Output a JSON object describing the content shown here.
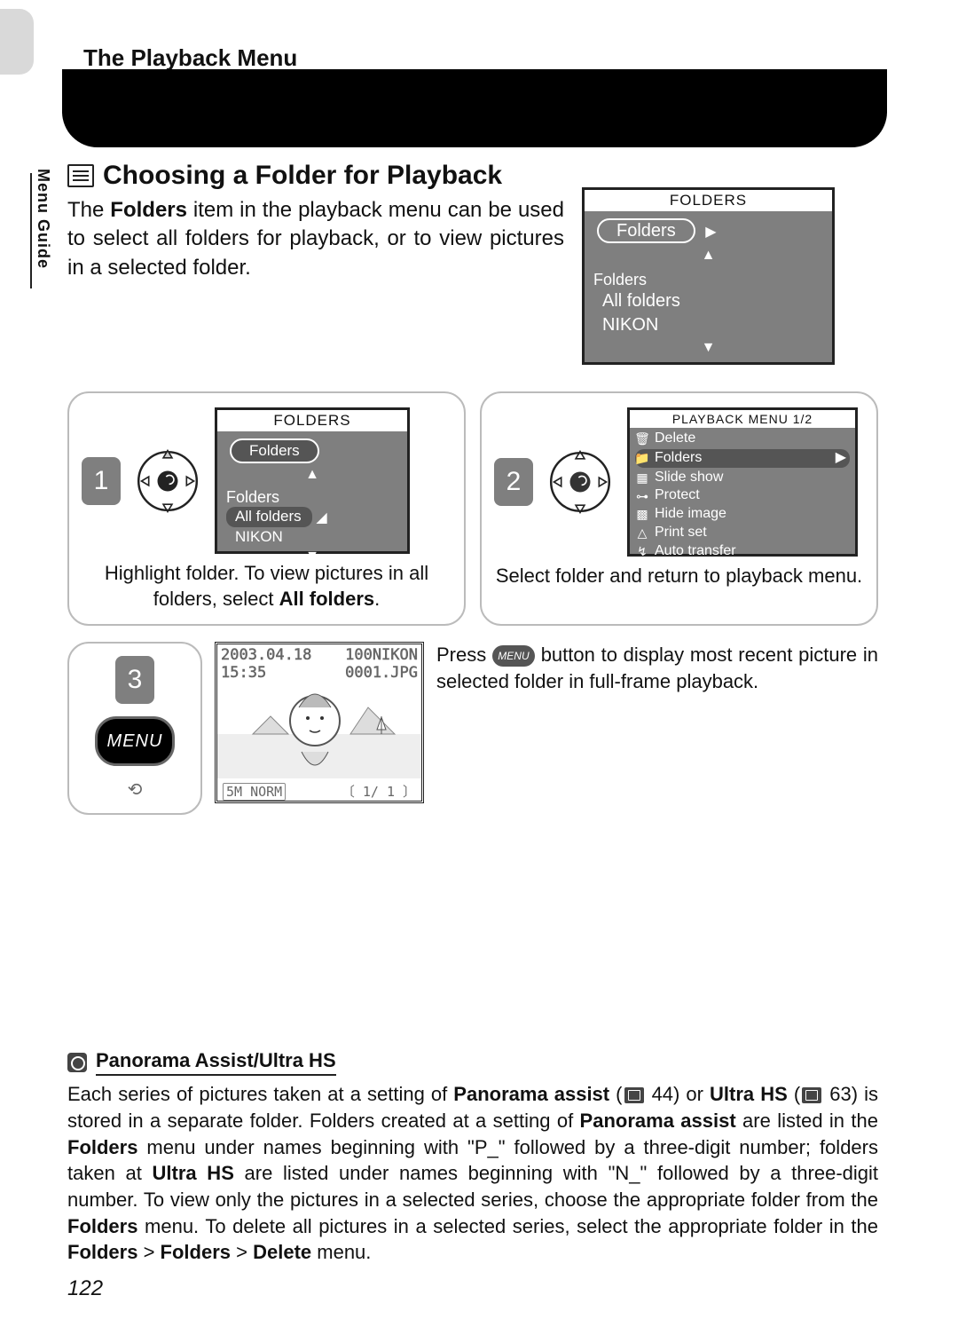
{
  "header": {
    "title": "The Playback Menu"
  },
  "side_label": "Menu Guide",
  "section": {
    "title": "Choosing a Folder for Playback",
    "intro_pre": "The ",
    "intro_bold": "Folders",
    "intro_post": " item in the playback menu can be used to select all folders for playback, or to view pictures in a selected folder."
  },
  "lcd_top": {
    "title": "FOLDERS",
    "pill": "Folders",
    "group": "Folders",
    "lines": [
      "All folders",
      "NIKON"
    ]
  },
  "step1": {
    "num": "1",
    "lcd": {
      "title": "FOLDERS",
      "pill": "Folders",
      "group": "Folders",
      "lines": [
        "All folders",
        "NIKON"
      ]
    },
    "cap_pre": "Highlight folder. To view pictures in all folders, select ",
    "cap_bold": "All folders",
    "cap_post": "."
  },
  "step2": {
    "num": "2",
    "lcd": {
      "title": "PLAYBACK MENU 1/2",
      "items": [
        {
          "icon": "🗑",
          "label": "Delete"
        },
        {
          "icon": "📁",
          "label": "Folders",
          "select": true,
          "arrow": true
        },
        {
          "icon": "▦",
          "label": "Slide show"
        },
        {
          "icon": "⊶",
          "label": "Protect"
        },
        {
          "icon": "▩",
          "label": "Hide image"
        },
        {
          "icon": "△",
          "label": "Print set"
        },
        {
          "icon": "↯",
          "label": "Auto transfer"
        }
      ]
    },
    "cap": "Select folder and return to playback menu."
  },
  "step3": {
    "num": "3",
    "preview": {
      "date": "2003.04.18",
      "folder": "100NIKON",
      "time": "15:35",
      "file": "0001.JPG",
      "size": "5M",
      "mode": "NORM",
      "index": "1/",
      "count": "1"
    },
    "text_pre": "Press ",
    "menu_label": "MENU",
    "text_post": " button to display most recent picture in selected folder in full-frame playback."
  },
  "menu_button": "MENU",
  "note": {
    "title": "Panorama Assist/Ultra HS",
    "p": "Each series of pictures taken at a setting of ",
    "b1": "Panorama assist",
    "ref1": " 44) or ",
    "b2": "Ultra HS",
    "ref2": " 63) is stored in a separate folder.  Folders created at a setting of ",
    "b3": "Panorama assist",
    "p2": " are listed in the ",
    "b4": "Folders",
    "p3": " menu under names beginning with \"P_\" followed by a three-digit number; folders taken at ",
    "b5": "Ultra HS",
    "p4": " are listed under names beginning with \"N_\" followed by a three-digit number.  To view only the pictures in a selected series, choose the appropriate folder from the ",
    "b6": "Folders",
    "p5": " menu.  To delete all pictures in a selected series, select the appropriate folder in the ",
    "b7": "Folders",
    "gt1": " > ",
    "b8": "Folders",
    "gt2": " > ",
    "b9": "Delete",
    "p6": " menu."
  },
  "page_num": "122"
}
